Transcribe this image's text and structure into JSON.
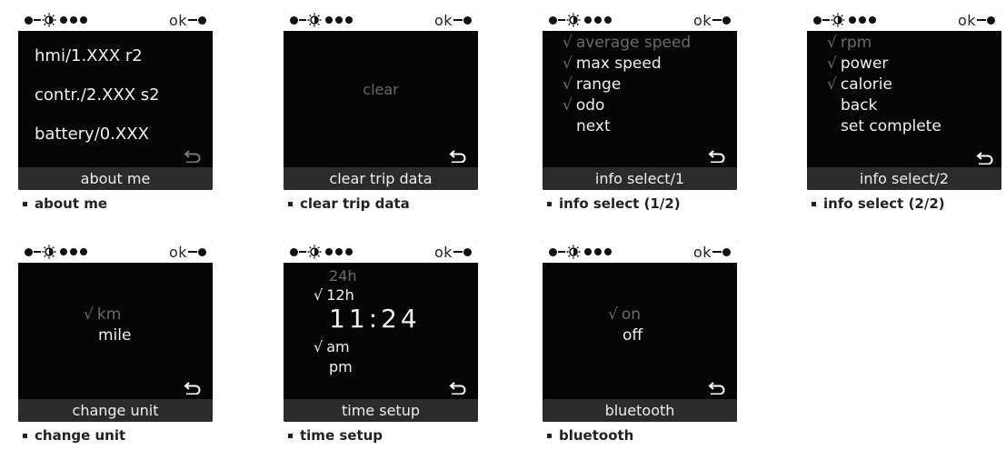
{
  "status": {
    "ok_label": "ok"
  },
  "back_icon": "back-arrow-icon",
  "cards": {
    "about": {
      "lines": [
        "hmi/1.XXX  r2",
        "contr./2.XXX  s2",
        "battery/0.XXX"
      ],
      "footer": "about me",
      "caption": "about me"
    },
    "clear": {
      "center": "clear",
      "footer": "clear trip data",
      "caption": "clear trip data"
    },
    "info1": {
      "items": [
        {
          "label": "average speed",
          "checked": true,
          "dim": true
        },
        {
          "label": "max speed",
          "checked": true,
          "dim": false
        },
        {
          "label": "range",
          "checked": true,
          "dim": false
        },
        {
          "label": "odo",
          "checked": true,
          "dim": false
        },
        {
          "label": "next",
          "checked": false,
          "dim": false
        }
      ],
      "check_glyph": "√",
      "footer": "info select/1",
      "caption": "info select (1/2)"
    },
    "info2": {
      "items": [
        {
          "label": "rpm",
          "checked": true,
          "dim": true
        },
        {
          "label": "power",
          "checked": true,
          "dim": false
        },
        {
          "label": "calorie",
          "checked": true,
          "dim": false
        },
        {
          "label": "back",
          "checked": false,
          "dim": false
        },
        {
          "label": "set complete",
          "checked": false,
          "dim": false
        }
      ],
      "check_glyph": "√",
      "footer": "info select/2",
      "caption": "info select (2/2)"
    },
    "unit": {
      "options": [
        {
          "label": "km",
          "checked": true,
          "dim": true
        },
        {
          "label": "mile",
          "checked": false,
          "dim": false
        }
      ],
      "check_glyph": "√",
      "footer": "change unit",
      "caption": "change unit"
    },
    "time": {
      "format_24": "24h",
      "format_12": "12h",
      "clock": "11:24",
      "am": "am",
      "pm": "pm",
      "check_glyph": "√",
      "footer": "time setup",
      "caption": "time setup"
    },
    "bluetooth": {
      "options": [
        {
          "label": "on",
          "checked": true,
          "dim": true
        },
        {
          "label": "off",
          "checked": false,
          "dim": false
        }
      ],
      "check_glyph": "√",
      "footer": "bluetooth",
      "caption": "bluetooth"
    }
  }
}
